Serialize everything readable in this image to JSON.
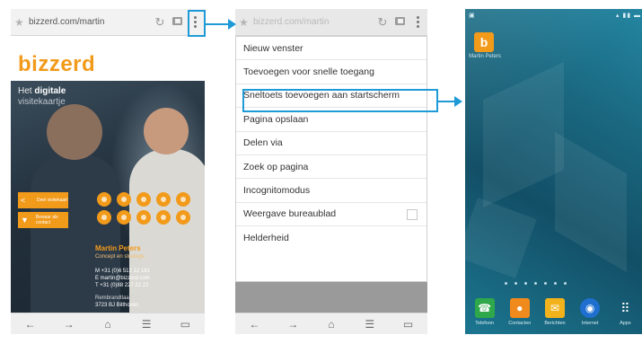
{
  "screen1": {
    "url": "bizzerd.com/martin",
    "logo": "bizzerd",
    "tagline_pre": "Het",
    "tagline_bold": "digitale",
    "tagline_sub": "visitekaartje",
    "share_label": "Deel visitekaart",
    "save_label": "Bewaar als contact",
    "contact": {
      "name": "Martin Peters",
      "role": "Concept en strategie",
      "mobile": "M +31 (0)6 512 12 161",
      "email": "E martin@bizzerd.com",
      "phone": "T +31 (0)88 227 22 22",
      "street": "Rembrandtlaan 24",
      "city": "3723 BJ Bilthoven"
    }
  },
  "screen2": {
    "url": "bizzerd.com/martin",
    "menu_items": [
      "Nieuw venster",
      "Toevoegen voor snelle toegang",
      "Sneltoets toevoegen aan startscherm",
      "Pagina opslaan",
      "Delen via",
      "Zoek op pagina",
      "Incognitomodus",
      "Weergave bureaublad",
      "Helderheid"
    ]
  },
  "screen3": {
    "app_label": "Martin Peters",
    "dock": [
      {
        "label": "Telefoon",
        "icon": "phone-icon",
        "color": "#2ea84a"
      },
      {
        "label": "Contacten",
        "icon": "contacts-icon",
        "color": "#f08a1c"
      },
      {
        "label": "Berichten",
        "icon": "messages-icon",
        "color": "#f2b21b"
      },
      {
        "label": "Internet",
        "icon": "globe-icon",
        "color": "#1e6fd0"
      },
      {
        "label": "Apps",
        "icon": "apps-grid-icon",
        "color": "#ffffff"
      }
    ]
  },
  "colors": {
    "accent": "#f29a1a",
    "highlight": "#1e9bd7"
  }
}
